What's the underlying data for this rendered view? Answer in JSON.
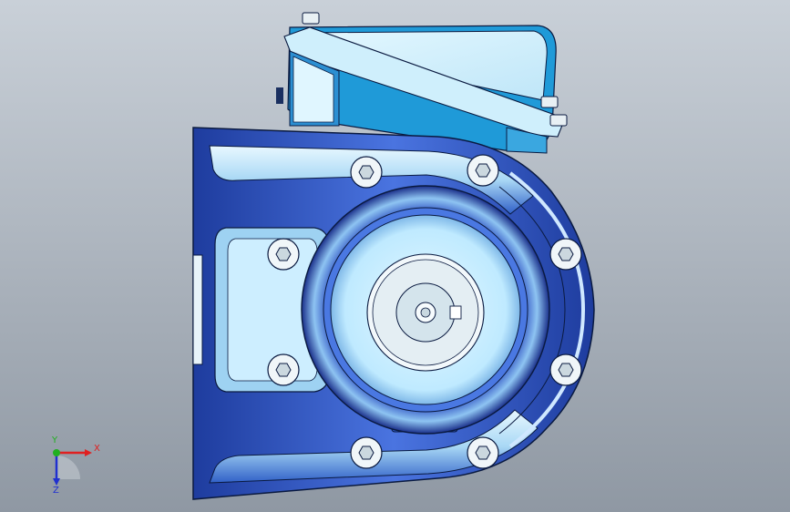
{
  "viewport": {
    "background_top": "#c9d0d8",
    "background_bottom": "#8f98a3"
  },
  "model": {
    "body_color": "#3558c8",
    "highlight_color": "#d8f4ff",
    "face_color": "#bfeaff",
    "edge_color": "#0a1a40",
    "cover_color": "#cfeffc",
    "cover_accent_color": "#1f9ad8"
  },
  "triad": {
    "x_label": "X",
    "y_label": "Y",
    "z_label": "Z",
    "x_color": "#e02020",
    "y_color": "#20b020",
    "z_color": "#2030d0"
  }
}
